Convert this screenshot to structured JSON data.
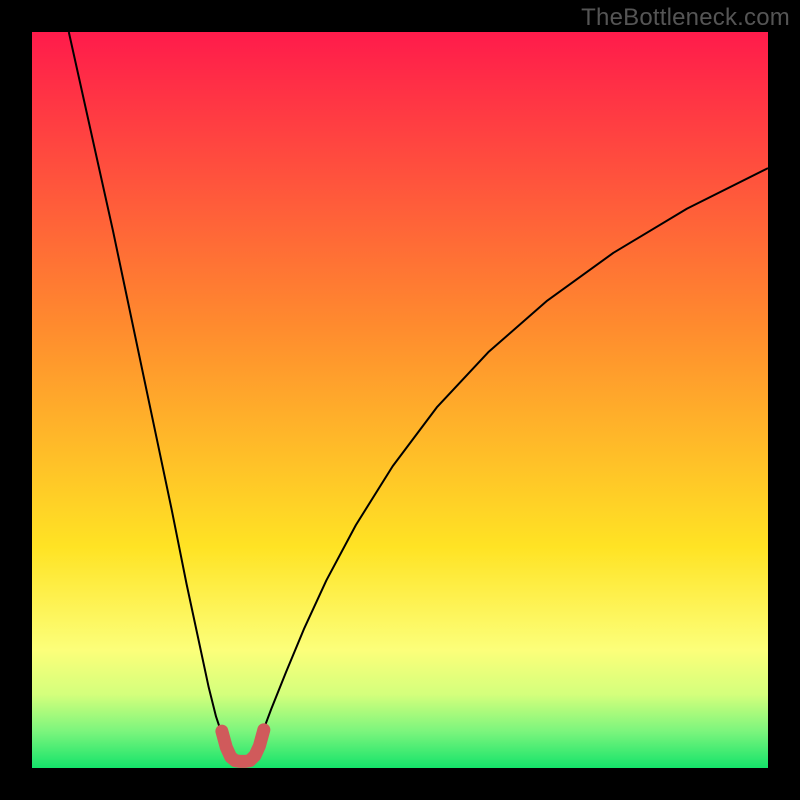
{
  "watermark": {
    "text": "TheBottleneck.com"
  },
  "chart_data": {
    "type": "line",
    "title": "",
    "xlabel": "",
    "ylabel": "",
    "xlim": [
      0,
      100
    ],
    "ylim": [
      0,
      100
    ],
    "grid": false,
    "legend": false,
    "background_gradient": {
      "stops": [
        {
          "offset": 0.0,
          "color": "#ff1b4b"
        },
        {
          "offset": 0.4,
          "color": "#ff8b2e"
        },
        {
          "offset": 0.7,
          "color": "#ffe324"
        },
        {
          "offset": 0.84,
          "color": "#fcff7a"
        },
        {
          "offset": 0.9,
          "color": "#d4ff7c"
        },
        {
          "offset": 0.95,
          "color": "#7cf57d"
        },
        {
          "offset": 1.0,
          "color": "#14e36a"
        }
      ]
    },
    "series": [
      {
        "name": "curve-left",
        "color": "#000000",
        "width": 2,
        "x": [
          5,
          7,
          9,
          11,
          13,
          15,
          17,
          19,
          21,
          22.5,
          24,
          25,
          26,
          26.7
        ],
        "y": [
          100,
          91,
          82,
          73,
          63.5,
          54,
          44.5,
          35,
          25,
          18,
          11,
          7,
          4,
          2
        ]
      },
      {
        "name": "curve-right",
        "color": "#000000",
        "width": 2,
        "x": [
          30.2,
          31,
          32.5,
          34.5,
          37,
          40,
          44,
          49,
          55,
          62,
          70,
          79,
          89,
          100
        ],
        "y": [
          2,
          4,
          8,
          13,
          19,
          25.5,
          33,
          41,
          49,
          56.5,
          63.5,
          70,
          76,
          81.5
        ]
      },
      {
        "name": "sweet-spot",
        "color": "#d05a5b",
        "width": 13,
        "linecap": "round",
        "x": [
          25.8,
          26.4,
          27.0,
          27.6,
          28.3,
          29.0,
          29.6,
          30.3,
          30.9,
          31.5
        ],
        "y": [
          5.0,
          2.8,
          1.5,
          1.0,
          0.9,
          0.9,
          1.0,
          1.7,
          3.0,
          5.2
        ]
      }
    ]
  }
}
